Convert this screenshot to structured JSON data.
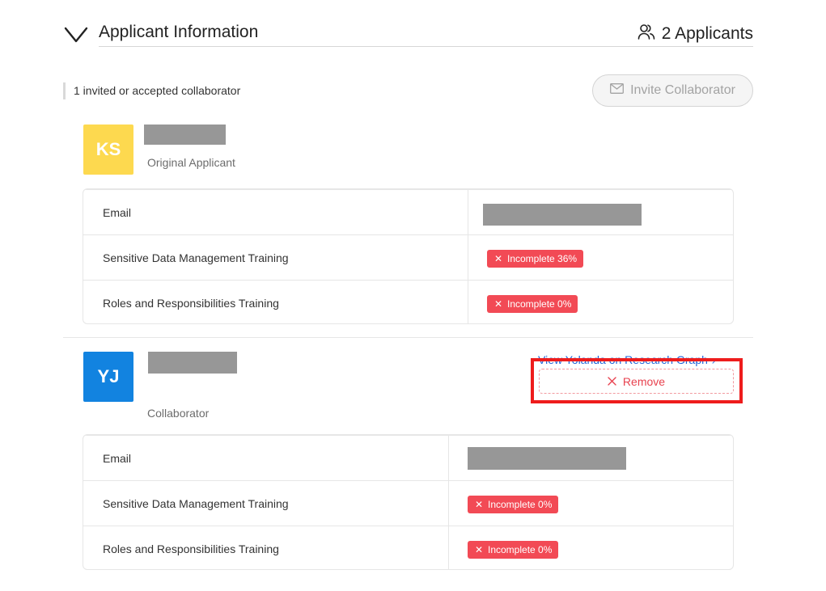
{
  "header": {
    "title": "Applicant Information",
    "applicant_count_label": "2 Applicants"
  },
  "collaborators": {
    "count_label": "1 invited or accepted collaborator",
    "invite_label": "Invite Collaborator"
  },
  "applicants": [
    {
      "initials": "KS",
      "role": "Original Applicant",
      "avatar_color": "#fdd94f",
      "rows": [
        {
          "label": "Email",
          "value": ""
        },
        {
          "label": "Sensitive Data Management Training",
          "status": "Incomplete 36%"
        },
        {
          "label": "Roles and Responsibilities Training",
          "status": "Incomplete 0%"
        }
      ]
    },
    {
      "initials": "YJ",
      "role": "Collaborator",
      "avatar_color": "#1283e0",
      "link_label": "View Yolanda on Research Graph",
      "remove_label": "Remove",
      "rows": [
        {
          "label": "Email",
          "value": ""
        },
        {
          "label": "Sensitive Data Management Training",
          "status": "Incomplete 0%"
        },
        {
          "label": "Roles and Responsibilities Training",
          "status": "Incomplete 0%"
        }
      ]
    }
  ],
  "colors": {
    "badge_red": "#f24a55",
    "link_blue": "#1f63d8",
    "highlight_red": "#ee1c1c"
  }
}
